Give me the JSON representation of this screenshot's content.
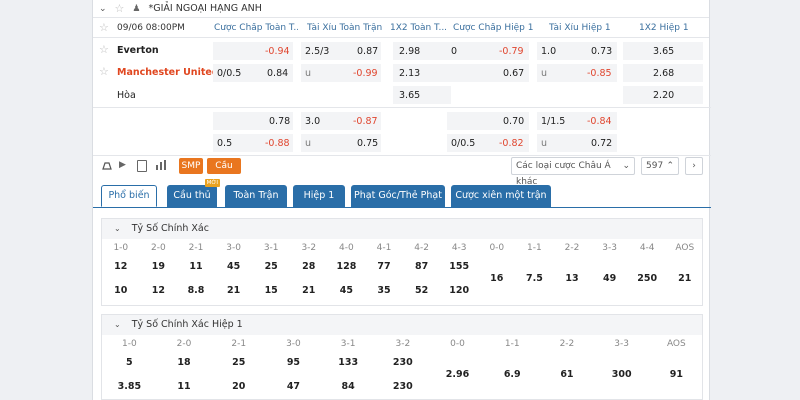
{
  "league": {
    "name": "*GIẢI NGOẠI HẠNG ANH"
  },
  "header": {
    "time": "09/06 08:00PM",
    "cols": [
      "Cược Chấp Toàn T...",
      "Tài Xỉu Toàn Trận",
      "1X2 Toàn T...",
      "Cược Chấp Hiệp 1",
      "Tài Xỉu Hiệp 1",
      "1X2 Hiệp 1"
    ]
  },
  "match": {
    "team1": "Everton",
    "team2": "Manchester United",
    "draw": "Hòa",
    "r1": {
      "hc_val": "-0.94",
      "ou_line": "2.5/3",
      "ou_val": "0.87",
      "x12": "2.98",
      "h1_line": "0",
      "h1_val": "-0.79",
      "ou1_line": "1.0",
      "ou1_val": "0.73",
      "x12h1": "3.65"
    },
    "r2": {
      "hc_line": "0/0.5",
      "hc_val": "0.84",
      "ou_u": "u",
      "ou_val": "-0.99",
      "x12": "2.13",
      "h1_val": "0.67",
      "ou1_u": "u",
      "ou1_val": "-0.85",
      "x12h1": "2.68"
    },
    "r3": {
      "x12": "3.65",
      "x12h1": "2.20"
    },
    "r4": {
      "hc_val": "0.78",
      "ou_line": "3.0",
      "ou_val": "-0.87",
      "h1_val": "0.70",
      "ou1_line": "1/1.5",
      "ou1_val": "-0.84"
    },
    "r5": {
      "hc_line": "0.5",
      "hc_val": "-0.88",
      "ou_u": "u",
      "ou_val": "0.75",
      "h1_line": "0/0.5",
      "h1_val": "-0.82",
      "ou1_u": "u",
      "ou1_val": "0.72"
    }
  },
  "toolbar": {
    "smp": "SMP",
    "player": "Cầu thủ",
    "bet_type": "Các loại cược Châu Á khác",
    "count": "597"
  },
  "tabs": [
    {
      "label": "Phổ biến"
    },
    {
      "label": "Cầu thủ",
      "badge": "MỚI"
    },
    {
      "label": "Toàn Trận"
    },
    {
      "label": "Hiệp 1"
    },
    {
      "label": "Phạt Góc/Thẻ Phạt"
    },
    {
      "label": "Cược xiên một trận"
    }
  ],
  "correct_score": {
    "title": "Tỷ Số Chính Xác",
    "headers": [
      "1-0",
      "2-0",
      "2-1",
      "3-0",
      "3-1",
      "3-2",
      "4-0",
      "4-1",
      "4-2",
      "4-3",
      "0-0",
      "1-1",
      "2-2",
      "3-3",
      "4-4",
      "AOS"
    ],
    "row1": [
      "12",
      "19",
      "11",
      "45",
      "25",
      "28",
      "128",
      "77",
      "87",
      "155"
    ],
    "row2": [
      "10",
      "12",
      "8.8",
      "21",
      "15",
      "21",
      "45",
      "35",
      "52",
      "120"
    ],
    "draws": [
      "16",
      "7.5",
      "13",
      "49",
      "250",
      "21"
    ]
  },
  "correct_score_h1": {
    "title": "Tỷ Số Chính Xác Hiệp 1",
    "headers": [
      "1-0",
      "2-0",
      "2-1",
      "3-0",
      "3-1",
      "3-2",
      "0-0",
      "1-1",
      "2-2",
      "3-3",
      "AOS"
    ],
    "row1": [
      "5",
      "18",
      "25",
      "95",
      "133",
      "230"
    ],
    "row2": [
      "3.85",
      "11",
      "20",
      "47",
      "84",
      "230"
    ],
    "draws": [
      "2.96",
      "6.9",
      "61",
      "300",
      "91"
    ]
  }
}
